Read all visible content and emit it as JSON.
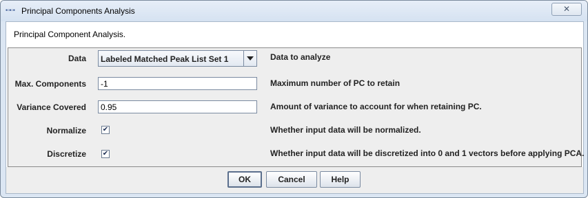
{
  "window": {
    "title": "Principal Components Analysis",
    "icon": "app-icon",
    "close_symbol": "✕"
  },
  "header": {
    "text": "Principal Component Analysis."
  },
  "fields": {
    "data": {
      "label": "Data",
      "value": "Labeled Matched Peak List Set 1",
      "description": "Data to analyze"
    },
    "max_components": {
      "label": "Max. Components",
      "value": "-1",
      "description": "Maximum number of PC to retain"
    },
    "variance_covered": {
      "label": "Variance Covered",
      "value": "0.95",
      "description": "Amount of variance to account for when retaining PC."
    },
    "normalize": {
      "label": "Normalize",
      "checked": true,
      "check_mark": "✔",
      "description": "Whether input data will be normalized."
    },
    "discretize": {
      "label": "Discretize",
      "checked": true,
      "check_mark": "✔",
      "description": "Whether input data will be discretized into 0 and 1 vectors before applying PCA."
    }
  },
  "buttons": {
    "ok": "OK",
    "cancel": "Cancel",
    "help": "Help"
  }
}
